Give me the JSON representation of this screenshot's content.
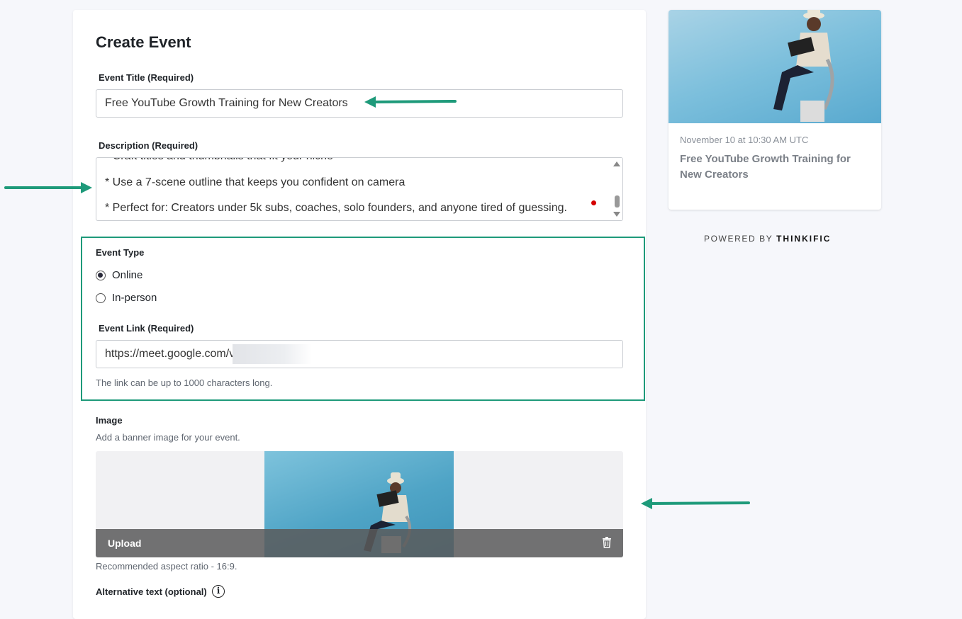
{
  "form": {
    "heading": "Create Event",
    "title_label": "Event Title (Required)",
    "title_value": "Free YouTube Growth Training for New Creators",
    "description_label": "Description (Required)",
    "description_lines": [
      "* Craft titles and thumbnails that fit your niche",
      "* Use a 7-scene outline that keeps you confident on camera",
      "* Perfect for: Creators under 5k subs, coaches, solo founders, and anyone tired of guessing."
    ],
    "event_type_label": "Event Type",
    "event_type_options": [
      "Online",
      "In-person"
    ],
    "event_type_selected": "Online",
    "event_link_label": "Event Link (Required)",
    "event_link_value": "https://meet.google.com/v",
    "event_link_help": "The link can be up to 1000 characters long.",
    "image_label": "Image",
    "image_help": "Add a banner image for your event.",
    "upload_label": "Upload",
    "aspect_help": "Recommended aspect ratio - 16:9.",
    "alt_text_label": "Alternative text (optional)",
    "info_icon": "i"
  },
  "preview": {
    "date": "November 10 at 10:30 AM UTC",
    "title": "Free YouTube Growth Training for New Creators"
  },
  "footer": {
    "powered_prefix": "POWERED BY",
    "brand": "THINKIFIC"
  },
  "colors": {
    "annotation": "#1e9a7a",
    "page_bg": "#f6f7fb"
  }
}
